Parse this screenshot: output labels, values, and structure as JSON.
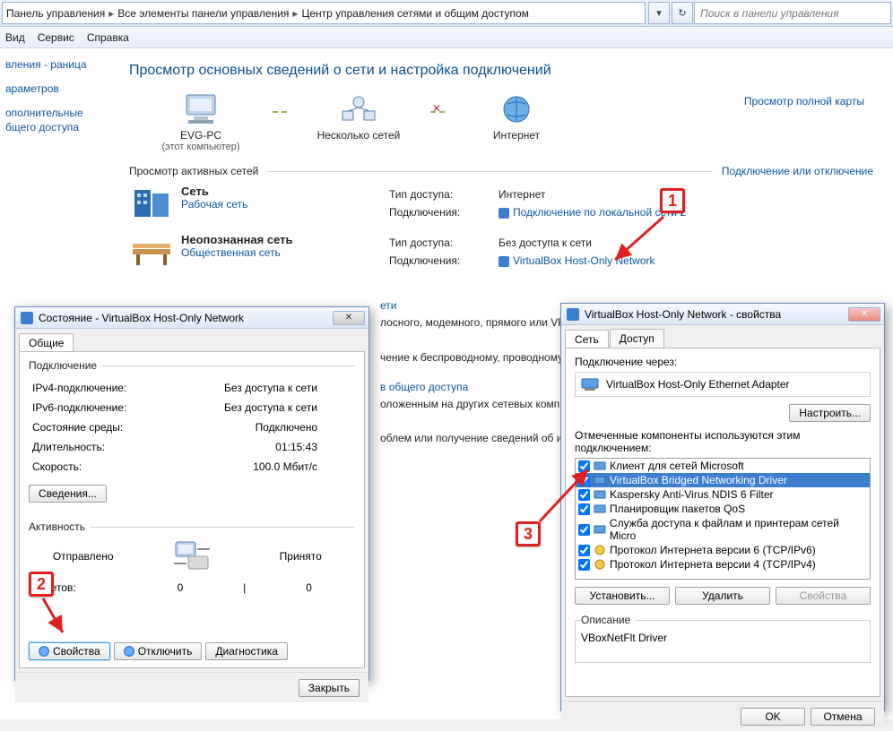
{
  "breadcrumb": {
    "a": "Панель управления",
    "b": "Все элементы панели управления",
    "c": "Центр управления сетями и общим доступом"
  },
  "search_placeholder": "Поиск в панели управления",
  "menu": {
    "view": "Вид",
    "tools": "Сервис",
    "help": "Справка"
  },
  "sidebar": {
    "home": "вления - раница",
    "params": "араметров",
    "advanced": "ополнительные бщего доступа"
  },
  "page": {
    "title": "Просмотр основных сведений о сети и настройка подключений",
    "map_link": "Просмотр полной карты",
    "map": {
      "pc": "EVG-PC",
      "pc_sub": "(этот компьютер)",
      "multi": "Несколько сетей",
      "internet": "Интернет"
    },
    "section_active": "Просмотр активных сетей",
    "section_connect": "Подключение или отключение",
    "net1": {
      "name": "Сеть",
      "type": "Рабочая сеть",
      "access_lbl": "Тип доступа:",
      "access_val": "Интернет",
      "conn_lbl": "Подключения:",
      "conn_val": "Подключение по локальной сети 2"
    },
    "net2": {
      "name": "Неопознанная сеть",
      "type": "Общественная сеть",
      "access_lbl": "Тип доступа:",
      "access_val": "Без доступа к сети",
      "conn_lbl": "Подключения:",
      "conn_val": "VirtualBox Host-Only Network"
    },
    "bg": {
      "h1": "ети",
      "t1": "лосного, модемного, прямого или VPN-или точки доступа.",
      "h2": "",
      "t2": "чение к беспроводному, проводному, м лючения к VPN.",
      "h3": "в общего доступа",
      "t3": "оложенным на других сетевых компьютерах общего доступа.",
      "h4": "",
      "t4": "облем или получение сведений об исп"
    }
  },
  "status_dlg": {
    "title": "Состояние - VirtualBox Host-Only Network",
    "tab": "Общие",
    "group_conn": "Подключение",
    "ipv4_k": "IPv4-подключение:",
    "ipv4_v": "Без доступа к сети",
    "ipv6_k": "IPv6-подключение:",
    "ipv6_v": "Без доступа к сети",
    "media_k": "Состояние среды:",
    "media_v": "Подключено",
    "dur_k": "Длительность:",
    "dur_v": "01:15:43",
    "speed_k": "Скорость:",
    "speed_v": "100.0 Мбит/с",
    "details_btn": "Сведения...",
    "group_act": "Активность",
    "sent_lbl": "Отправлено",
    "recv_lbl": "Принято",
    "pkts_lbl": "Пакетов:",
    "pkts_sent": "0",
    "pkts_recv": "0",
    "props_btn": "Свойства",
    "disable_btn": "Отключить",
    "diag_btn": "Диагностика",
    "close_btn": "Закрыть"
  },
  "props_dlg": {
    "title": "VirtualBox Host-Only Network - свойства",
    "tab_net": "Сеть",
    "tab_access": "Доступ",
    "conn_via": "Подключение через:",
    "adapter": "VirtualBox Host-Only Ethernet Adapter",
    "configure_btn": "Настроить...",
    "components_lbl": "Отмеченные компоненты используются этим подключением:",
    "components": [
      {
        "label": "Клиент для сетей Microsoft",
        "checked": true,
        "selected": false
      },
      {
        "label": "VirtualBox Bridged Networking Driver",
        "checked": true,
        "selected": true
      },
      {
        "label": "Kaspersky Anti-Virus NDIS 6 Filter",
        "checked": true,
        "selected": false
      },
      {
        "label": "Планировщик пакетов QoS",
        "checked": true,
        "selected": false
      },
      {
        "label": "Служба доступа к файлам и принтерам сетей Micro",
        "checked": true,
        "selected": false
      },
      {
        "label": "Протокол Интернета версии 6 (TCP/IPv6)",
        "checked": true,
        "selected": false
      },
      {
        "label": "Протокол Интернета версии 4 (TCP/IPv4)",
        "checked": true,
        "selected": false
      }
    ],
    "install_btn": "Установить...",
    "remove_btn": "Удалить",
    "props_btn": "Свойства",
    "desc_lbl": "Описание",
    "desc_val": "VBoxNetFlt Driver",
    "ok_btn": "OK",
    "cancel_btn": "Отмена"
  },
  "callouts": {
    "c1": "1",
    "c2": "2",
    "c3": "3"
  }
}
